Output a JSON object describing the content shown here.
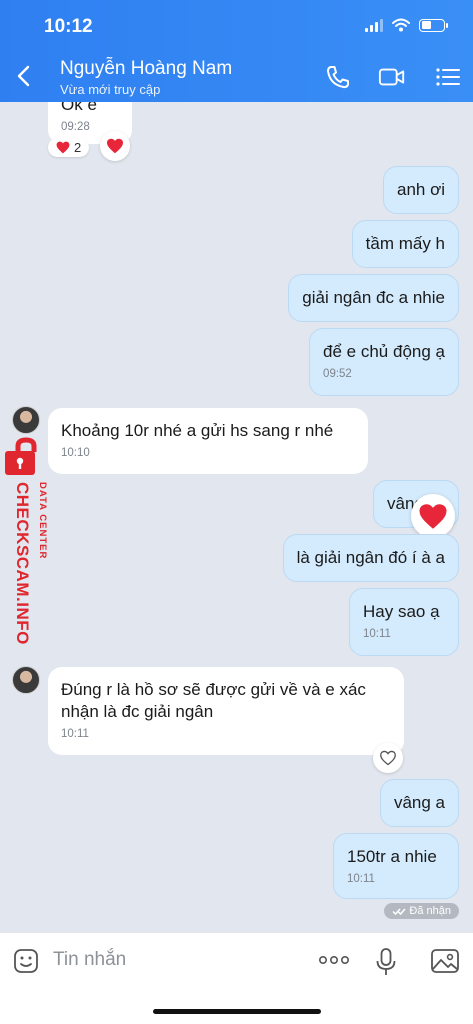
{
  "status_bar": {
    "time": "10:12"
  },
  "header": {
    "contact_name": "Nguyễn Hoàng Nam",
    "contact_status": "Vừa mới truy cập"
  },
  "messages": [
    {
      "id": "m0",
      "side": "in",
      "text": "Ok e",
      "time": "09:28",
      "reaction_count": "2"
    },
    {
      "id": "m1",
      "side": "out",
      "text": "anh ơi"
    },
    {
      "id": "m2",
      "side": "out",
      "text": "tầm mấy h"
    },
    {
      "id": "m3",
      "side": "out",
      "text": "giải ngân đc a nhie"
    },
    {
      "id": "m4",
      "side": "out",
      "text": "để e chủ động ạ",
      "time": "09:52"
    },
    {
      "id": "m5",
      "side": "in",
      "text": "Khoảng 10r nhé a gửi hs sang r nhé",
      "time": "10:10"
    },
    {
      "id": "m6",
      "side": "out",
      "text": "vâng"
    },
    {
      "id": "m7",
      "side": "out",
      "text": "là giải ngân đó í à a"
    },
    {
      "id": "m8",
      "side": "out",
      "text": "Hay sao ạ",
      "time": "10:11"
    },
    {
      "id": "m9",
      "side": "in",
      "text_line1": "Đúng r là hồ sơ sẽ được gửi về và e xác",
      "text_line2": "nhận là đc giải ngân",
      "time": "10:11"
    },
    {
      "id": "m10",
      "side": "out",
      "text": "vâng a"
    },
    {
      "id": "m11",
      "side": "out",
      "text": "150tr a nhie",
      "time": "10:11"
    }
  ],
  "delivery_status": "Đã nhận",
  "watermark": {
    "line1": "DATA CENTER",
    "line2": "CHECKSCAM.INFO"
  },
  "input": {
    "placeholder": "Tin nhắn"
  },
  "colors": {
    "header": "#3288f4",
    "out_bubble": "#d4ebfd",
    "in_bubble": "#ffffff",
    "background": "#e2e6ee",
    "heart": "#e8263a",
    "watermark": "#e0262e"
  },
  "icons": [
    "back-arrow-icon",
    "phone-icon",
    "video-call-icon",
    "list-menu-icon",
    "sticker-icon",
    "more-icon",
    "microphone-icon",
    "image-icon",
    "heart-icon"
  ]
}
